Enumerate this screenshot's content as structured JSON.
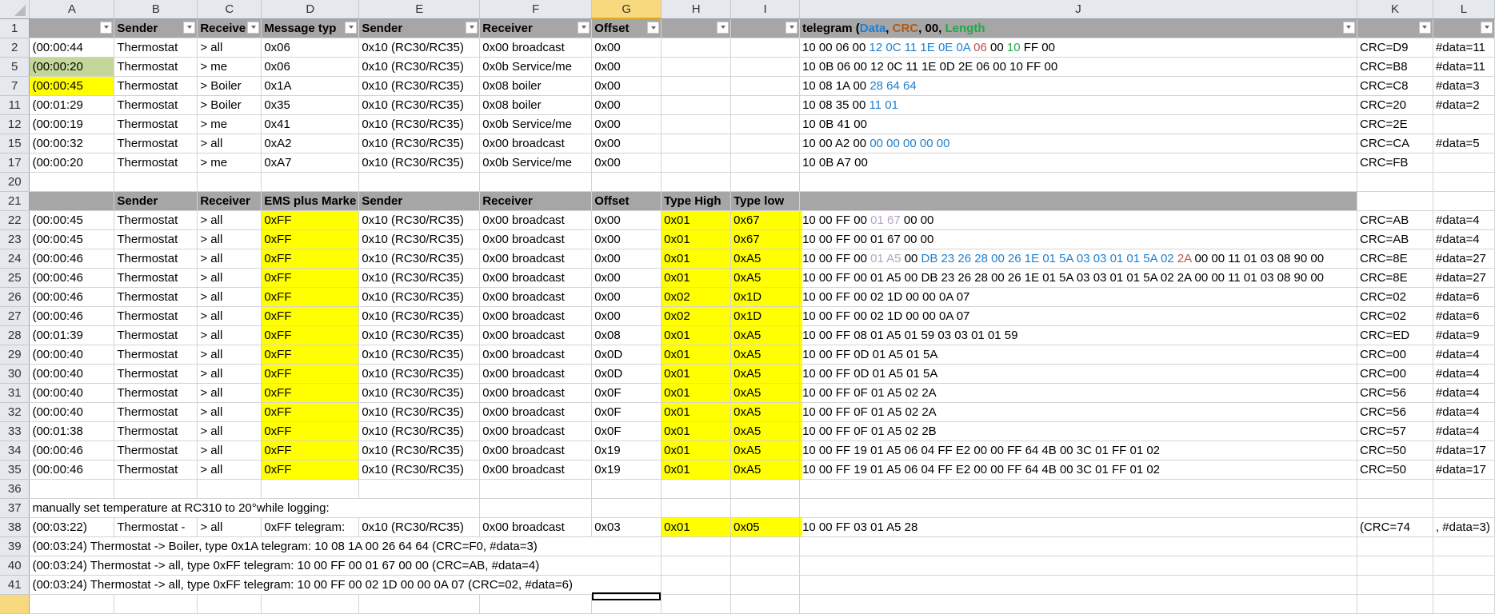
{
  "app": "spreadsheet",
  "columns": [
    "A",
    "B",
    "C",
    "D",
    "E",
    "F",
    "G",
    "H",
    "I",
    "J",
    "K",
    "L"
  ],
  "selected_column": "G",
  "header_row": {
    "row": "1",
    "cells": [
      "",
      "Sender",
      "Receive",
      "Message typ",
      "Sender",
      "Receiver",
      "Offset",
      "",
      "",
      "",
      "",
      ""
    ],
    "telegram_header": {
      "prefix": "telegram (",
      "data": "Data",
      "sep1": ", ",
      "crc": "CRC",
      "sep2": ", ",
      "zero": "00",
      "sep3": ", ",
      "length": "Length"
    }
  },
  "colors": {
    "data": "#1f7fcf",
    "crc": "#c0504d",
    "length": "#22a84a",
    "type": "#b3a2c7",
    "highlight_yellow": "#ffff00",
    "highlight_green": "#c4d79b",
    "header_gray": "#a6a6a6"
  },
  "section1_rows": [
    {
      "row": "2",
      "a": "(00:00:44",
      "b": "Thermostat",
      "c": "> all",
      "d": "0x06",
      "e": "0x10 (RC30/RC35)",
      "f": "0x00 broadcast",
      "g": "0x00",
      "tg_plain": "10 00 06 00 ",
      "tg_data": "12 0C 11 1E 0E 0A ",
      "tg_crc": "06 ",
      "tg_zero": "00 ",
      "tg_len": "10 ",
      "tg_rest": "FF 00",
      "k": "CRC=D9",
      "l": "#data=11"
    },
    {
      "row": "5",
      "a": "(00:00:20",
      "b": "Thermostat",
      "c": "> me",
      "d": "0x06",
      "e": "0x10 (RC30/RC35)",
      "f": "0x0b Service/me",
      "g": "0x00",
      "tg_plain": "10 0B 06 00 12 0C 11 1E 0D 2E 06 00 10 FF 00",
      "k": "CRC=B8",
      "l": "#data=11"
    },
    {
      "row": "7",
      "a": "(00:00:45",
      "b": "Thermostat",
      "c": "> Boiler",
      "d": "0x1A",
      "e": "0x10 (RC30/RC35)",
      "f": "0x08 boiler",
      "g": "0x00",
      "tg_plain": "10 08 1A 00 ",
      "tg_data": "28 64 64",
      "k": "CRC=C8",
      "l": "#data=3"
    },
    {
      "row": "11",
      "a": "(00:01:29",
      "b": "Thermostat",
      "c": "> Boiler",
      "d": "0x35",
      "e": "0x10 (RC30/RC35)",
      "f": "0x08 boiler",
      "g": "0x00",
      "tg_plain": "10 08 35 00 ",
      "tg_data": "11 01",
      "k": "CRC=20",
      "l": "#data=2"
    },
    {
      "row": "12",
      "a": "(00:00:19",
      "b": "Thermostat",
      "c": "> me",
      "d": "0x41",
      "e": "0x10 (RC30/RC35)",
      "f": "0x0b Service/me",
      "g": "0x00",
      "tg_plain": "10 0B 41 00",
      "k": "CRC=2E",
      "l": ""
    },
    {
      "row": "15",
      "a": "(00:00:32",
      "b": "Thermostat",
      "c": "> all",
      "d": "0xA2",
      "e": "0x10 (RC30/RC35)",
      "f": "0x00 broadcast",
      "g": "0x00",
      "tg_plain": "10 00 A2 00 ",
      "tg_data": "00 00 00 00 00",
      "k": "CRC=CA",
      "l": "#data=5"
    },
    {
      "row": "17",
      "a": "(00:00:20",
      "b": "Thermostat",
      "c": "> me",
      "d": "0xA7",
      "e": "0x10 (RC30/RC35)",
      "f": "0x0b Service/me",
      "g": "0x00",
      "tg_plain": "10 0B A7 00",
      "k": "CRC=FB",
      "l": ""
    }
  ],
  "blank_row_20": "20",
  "section2_header": {
    "row": "21",
    "cells": [
      "",
      "Sender",
      "Receiver",
      "EMS plus Marke",
      "Sender",
      "Receiver",
      "Offset",
      "Type High",
      "Type low",
      "",
      "",
      ""
    ]
  },
  "section2_rows": [
    {
      "row": "22",
      "a": "(00:00:45",
      "b": "Thermostat",
      "c": "> all",
      "d": "0xFF",
      "e": "0x10 (RC30/RC35)",
      "f": "0x00 broadcast",
      "g": "0x00",
      "h": "0x01",
      "i": "0x67",
      "tg_plain": "10 00 FF 00 ",
      "tg_type": "01 67 ",
      "tg_rest": "00 00",
      "k": "CRC=AB",
      "l": "#data=4"
    },
    {
      "row": "23",
      "a": "(00:00:45",
      "b": "Thermostat",
      "c": "> all",
      "d": "0xFF",
      "e": "0x10 (RC30/RC35)",
      "f": "0x00 broadcast",
      "g": "0x00",
      "h": "0x01",
      "i": "0x67",
      "tg_plain": "10 00 FF 00 01 67 00 00",
      "k": "CRC=AB",
      "l": "#data=4"
    },
    {
      "row": "24",
      "a": "(00:00:46",
      "b": "Thermostat",
      "c": "> all",
      "d": "0xFF",
      "e": "0x10 (RC30/RC35)",
      "f": "0x00 broadcast",
      "g": "0x00",
      "h": "0x01",
      "i": "0xA5",
      "tg_plain": "10 00 FF 00 ",
      "tg_type": "01 A5 ",
      "tg_zero": "00 ",
      "tg_data": "DB 23 26 28 00 26 1E 01 5A 03 03 01 01 5A 02 ",
      "tg_crc": "2A ",
      "tg_rest": "00 00 11 01 03 08 90 00",
      "k": "CRC=8E",
      "l": "#data=27"
    },
    {
      "row": "25",
      "a": "(00:00:46",
      "b": "Thermostat",
      "c": "> all",
      "d": "0xFF",
      "e": "0x10 (RC30/RC35)",
      "f": "0x00 broadcast",
      "g": "0x00",
      "h": "0x01",
      "i": "0xA5",
      "tg_plain": "10 00 FF 00 01 A5 00 DB 23 26 28 00 26 1E 01 5A 03 03 01 01 5A 02 2A 00 00 11 01 03 08 90 00",
      "k": "CRC=8E",
      "l": "#data=27"
    },
    {
      "row": "26",
      "a": "(00:00:46",
      "b": "Thermostat",
      "c": "> all",
      "d": "0xFF",
      "e": "0x10 (RC30/RC35)",
      "f": "0x00 broadcast",
      "g": "0x00",
      "h": "0x02",
      "i": "0x1D",
      "tg_plain": "10 00 FF 00 02 1D 00 00 0A 07",
      "k": "CRC=02",
      "l": "#data=6"
    },
    {
      "row": "27",
      "a": "(00:00:46",
      "b": "Thermostat",
      "c": "> all",
      "d": "0xFF",
      "e": "0x10 (RC30/RC35)",
      "f": "0x00 broadcast",
      "g": "0x00",
      "h": "0x02",
      "i": "0x1D",
      "tg_plain": "10 00 FF 00 02 1D 00 00 0A 07",
      "k": "CRC=02",
      "l": "#data=6"
    },
    {
      "row": "28",
      "a": "(00:01:39",
      "b": "Thermostat",
      "c": "> all",
      "d": "0xFF",
      "e": "0x10 (RC30/RC35)",
      "f": "0x00 broadcast",
      "g": "0x08",
      "h": "0x01",
      "i": "0xA5",
      "tg_plain": "10 00 FF 08 01 A5 01 59 03 03 01 01 59",
      "k": "CRC=ED",
      "l": "#data=9"
    },
    {
      "row": "29",
      "a": "(00:00:40",
      "b": "Thermostat",
      "c": "> all",
      "d": "0xFF",
      "e": "0x10 (RC30/RC35)",
      "f": "0x00 broadcast",
      "g": "0x0D",
      "h": "0x01",
      "i": "0xA5",
      "tg_plain": "10 00 FF 0D 01 A5 01 5A",
      "k": "CRC=00",
      "l": "#data=4"
    },
    {
      "row": "30",
      "a": "(00:00:40",
      "b": "Thermostat",
      "c": "> all",
      "d": "0xFF",
      "e": "0x10 (RC30/RC35)",
      "f": "0x00 broadcast",
      "g": "0x0D",
      "h": "0x01",
      "i": "0xA5",
      "tg_plain": "10 00 FF 0D 01 A5 01 5A",
      "k": "CRC=00",
      "l": "#data=4"
    },
    {
      "row": "31",
      "a": "(00:00:40",
      "b": "Thermostat",
      "c": "> all",
      "d": "0xFF",
      "e": "0x10 (RC30/RC35)",
      "f": "0x00 broadcast",
      "g": "0x0F",
      "h": "0x01",
      "i": "0xA5",
      "tg_plain": "10 00 FF 0F 01 A5 02 2A",
      "k": "CRC=56",
      "l": "#data=4"
    },
    {
      "row": "32",
      "a": "(00:00:40",
      "b": "Thermostat",
      "c": "> all",
      "d": "0xFF",
      "e": "0x10 (RC30/RC35)",
      "f": "0x00 broadcast",
      "g": "0x0F",
      "h": "0x01",
      "i": "0xA5",
      "tg_plain": "10 00 FF 0F 01 A5 02 2A",
      "k": "CRC=56",
      "l": "#data=4"
    },
    {
      "row": "33",
      "a": "(00:01:38",
      "b": "Thermostat",
      "c": "> all",
      "d": "0xFF",
      "e": "0x10 (RC30/RC35)",
      "f": "0x00 broadcast",
      "g": "0x0F",
      "h": "0x01",
      "i": "0xA5",
      "tg_plain": "10 00 FF 0F 01 A5 02 2B",
      "k": "CRC=57",
      "l": "#data=4"
    },
    {
      "row": "34",
      "a": "(00:00:46",
      "b": "Thermostat",
      "c": "> all",
      "d": "0xFF",
      "e": "0x10 (RC30/RC35)",
      "f": "0x00 broadcast",
      "g": "0x19",
      "h": "0x01",
      "i": "0xA5",
      "tg_plain": "10 00 FF 19 01 A5 06 04 FF E2 00 00 FF 64 4B 00 3C 01 FF 01 02",
      "k": "CRC=50",
      "l": "#data=17"
    },
    {
      "row": "35",
      "a": "(00:00:46",
      "b": "Thermostat",
      "c": "> all",
      "d": "0xFF",
      "e": "0x10 (RC30/RC35)",
      "f": "0x00 broadcast",
      "g": "0x19",
      "h": "0x01",
      "i": "0xA5",
      "tg_plain": "10 00 FF 19 01 A5 06 04 FF E2 00 00 FF 64 4B 00 3C 01 FF 01 02",
      "k": "CRC=50",
      "l": "#data=17"
    }
  ],
  "blank_row_36": "36",
  "note_row": {
    "row": "37",
    "text": "manually set temperature at RC310 to 20°while logging:"
  },
  "row_38": {
    "row": "38",
    "a": "(00:03:22)",
    "b": "Thermostat -",
    "c": "> all",
    "d": "0xFF telegram:",
    "e": "0x10 (RC30/RC35)",
    "f": "0x00 broadcast",
    "g": "0x03",
    "h": "0x01",
    "i": "0x05",
    "j": "10 00 FF 03 01 A5 28",
    "k": "(CRC=74",
    "l": ", #data=3)"
  },
  "log_rows": [
    {
      "row": "39",
      "text": "(00:03:24) Thermostat -> Boiler, type 0x1A telegram: 10 08 1A 00 26 64 64 (CRC=F0, #data=3)"
    },
    {
      "row": "40",
      "text": "(00:03:24) Thermostat -> all, type 0xFF telegram: 10 00 FF 00 01 67 00 00 (CRC=AB, #data=4)"
    },
    {
      "row": "41",
      "text": "(00:03:24) Thermostat -> all, type 0xFF telegram: 10 00 FF 00 02 1D 00 00 0A 07 (CRC=02, #data=6)"
    }
  ]
}
